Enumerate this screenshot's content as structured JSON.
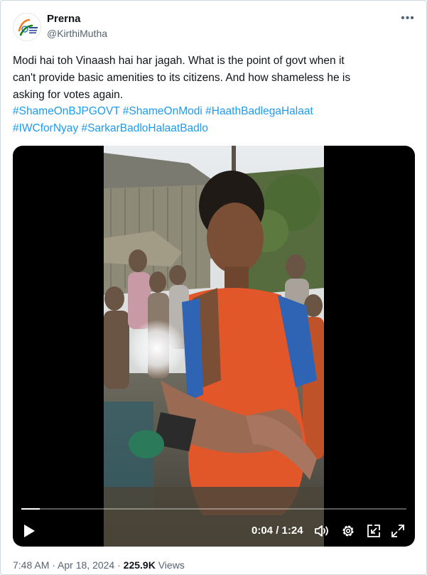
{
  "tweet": {
    "author": {
      "display_name": "Prerna",
      "handle": "@KirthiMutha",
      "avatar": "indian-national-congress-logo-icon"
    },
    "more_icon": "more-horizontal-icon",
    "text_lines": [
      "Modi hai toh Vinaash hai har jagah. What is the point of govt when it",
      "can't provide basic amenities to its citizens. And how shameless he is",
      "asking for votes again."
    ],
    "hashtags": [
      "#ShameOnBJPGOVT",
      "#ShameOnModi",
      "#HaathBadlegaHalaat",
      "#IWCforNyay",
      "#SarkarBadloHalaatBadlo"
    ],
    "hashtag_color": "#1d9bf0",
    "video": {
      "current_time": "0:04",
      "duration": "1:24",
      "time_display": "0:04 / 1:24",
      "progress": 0.048,
      "icons": [
        "play-icon",
        "volume-icon",
        "settings-gear-icon",
        "picture-in-picture-icon",
        "fullscreen-icon"
      ]
    },
    "meta": {
      "time": "7:48 AM",
      "date": "Apr 18, 2024",
      "views_count": "225.9K",
      "views_label": "Views"
    }
  }
}
